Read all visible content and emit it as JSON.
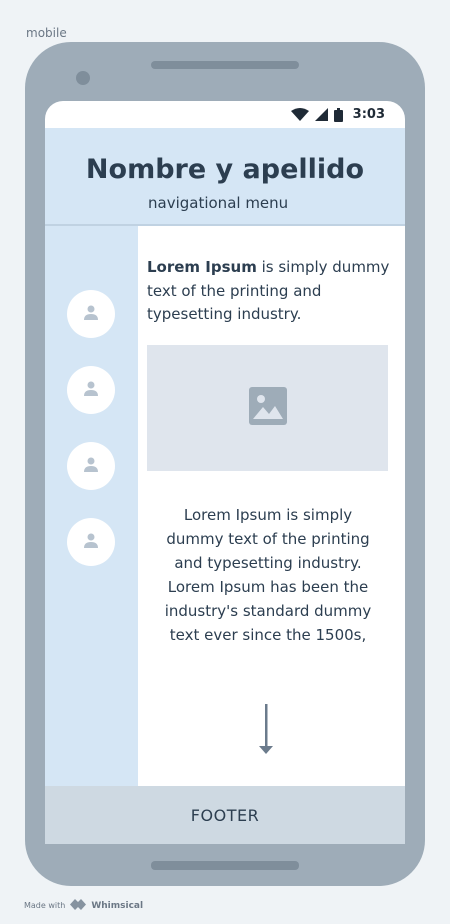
{
  "frame": {
    "label": "mobile"
  },
  "status_bar": {
    "time": "3:03"
  },
  "header": {
    "title": "Nombre y apellido",
    "nav_label": "navigational menu"
  },
  "sidebar": {
    "items": [
      {
        "icon": "user-icon"
      },
      {
        "icon": "user-icon"
      },
      {
        "icon": "user-icon"
      },
      {
        "icon": "user-icon"
      }
    ]
  },
  "main": {
    "intro_bold": "Lorem Ipsum",
    "intro_rest": " is simply dummy text of the printing and typesetting industry.",
    "image_icon": "image-icon",
    "body_text": "Lorem Ipsum is simply dummy text of the printing and typesetting industry. Lorem Ipsum has been the industry's standard dummy text ever since the 1500s,",
    "scroll_icon": "arrow-down-icon"
  },
  "footer": {
    "label": "FOOTER"
  },
  "credit": {
    "prefix": "Made with",
    "brand": "Whimsical"
  },
  "colors": {
    "header_bg": "#d5e6f5",
    "phone_body": "#9eacb8",
    "footer_bg": "#ced9e2",
    "placeholder_bg": "#dfe5ed",
    "text": "#2c3e50"
  }
}
